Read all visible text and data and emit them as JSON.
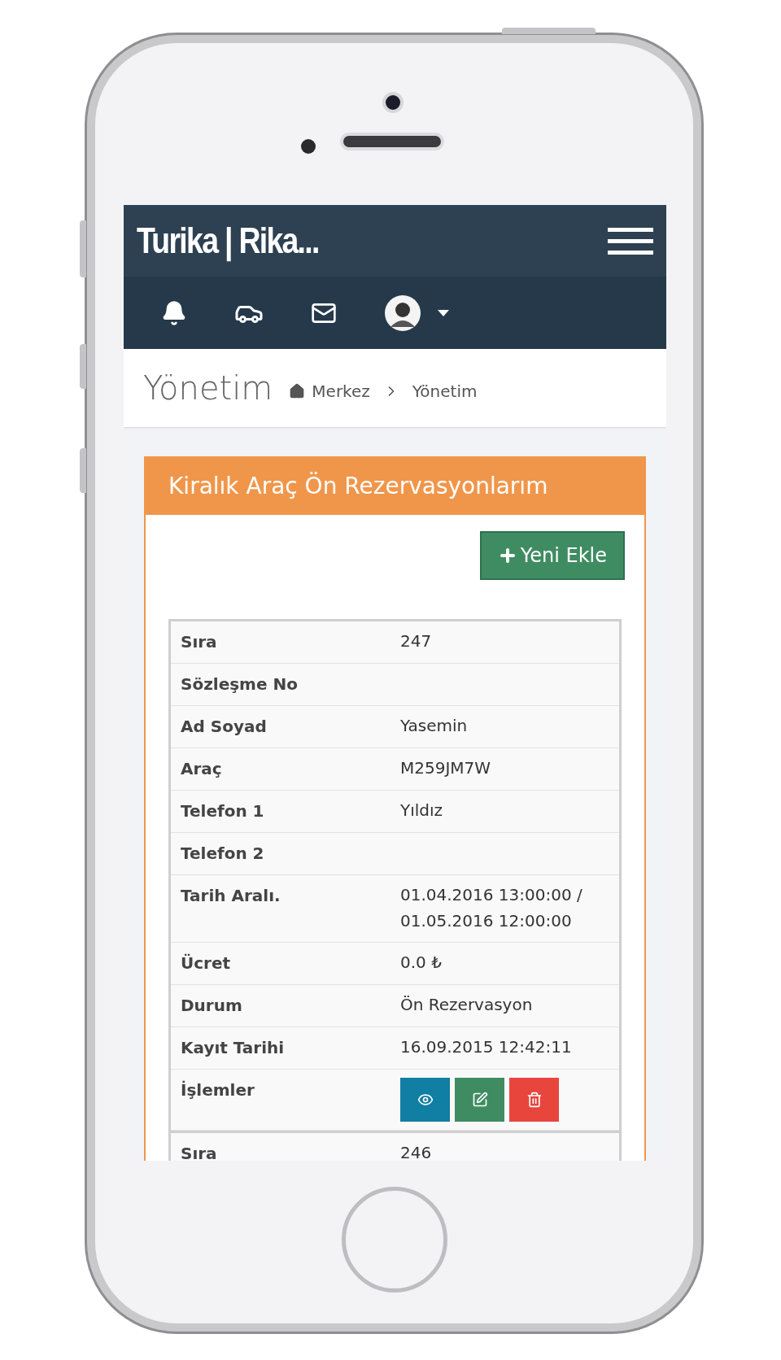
{
  "header": {
    "title": "Turika | Rika..."
  },
  "breadcrumb": {
    "page_title": "Yönetim",
    "items": [
      "Merkez",
      "Yönetim"
    ]
  },
  "panel": {
    "title": "Kiralık Araç Ön Rezervasyonlarım",
    "add_button": "Yeni Ekle",
    "records": [
      {
        "rows": [
          {
            "kind": "text",
            "label": "Sıra",
            "value": "247"
          },
          {
            "kind": "text",
            "label": "Sözleşme No"
          },
          {
            "kind": "text",
            "label": "Ad Soyad",
            "value": "Yasemin"
          },
          {
            "kind": "text",
            "label": "Araç",
            "value": "M259JM7W"
          },
          {
            "kind": "text",
            "label": "Telefon 1",
            "value": "Yıldız"
          },
          {
            "kind": "text",
            "label": "Telefon 2"
          },
          {
            "kind": "text",
            "label": "Tarih Aralı.",
            "value": "01.04.2016 13:00:00 / 01.05.2016 12:00:00"
          },
          {
            "kind": "text",
            "label": "Ücret",
            "value": "0.0 ₺"
          },
          {
            "kind": "text",
            "label": "Durum",
            "value": "Ön Rezervasyon"
          },
          {
            "kind": "text",
            "label": "Kayıt Tarihi",
            "value": "16.09.2015 12:42:11"
          },
          {
            "kind": "actions",
            "label": "İşlemler",
            "actions": [
              {
                "kind": "view"
              },
              {
                "kind": "edit"
              },
              {
                "kind": "delete"
              }
            ]
          }
        ]
      },
      {
        "rows": [
          {
            "kind": "text",
            "label": "Sıra",
            "value": "246"
          }
        ]
      }
    ]
  }
}
